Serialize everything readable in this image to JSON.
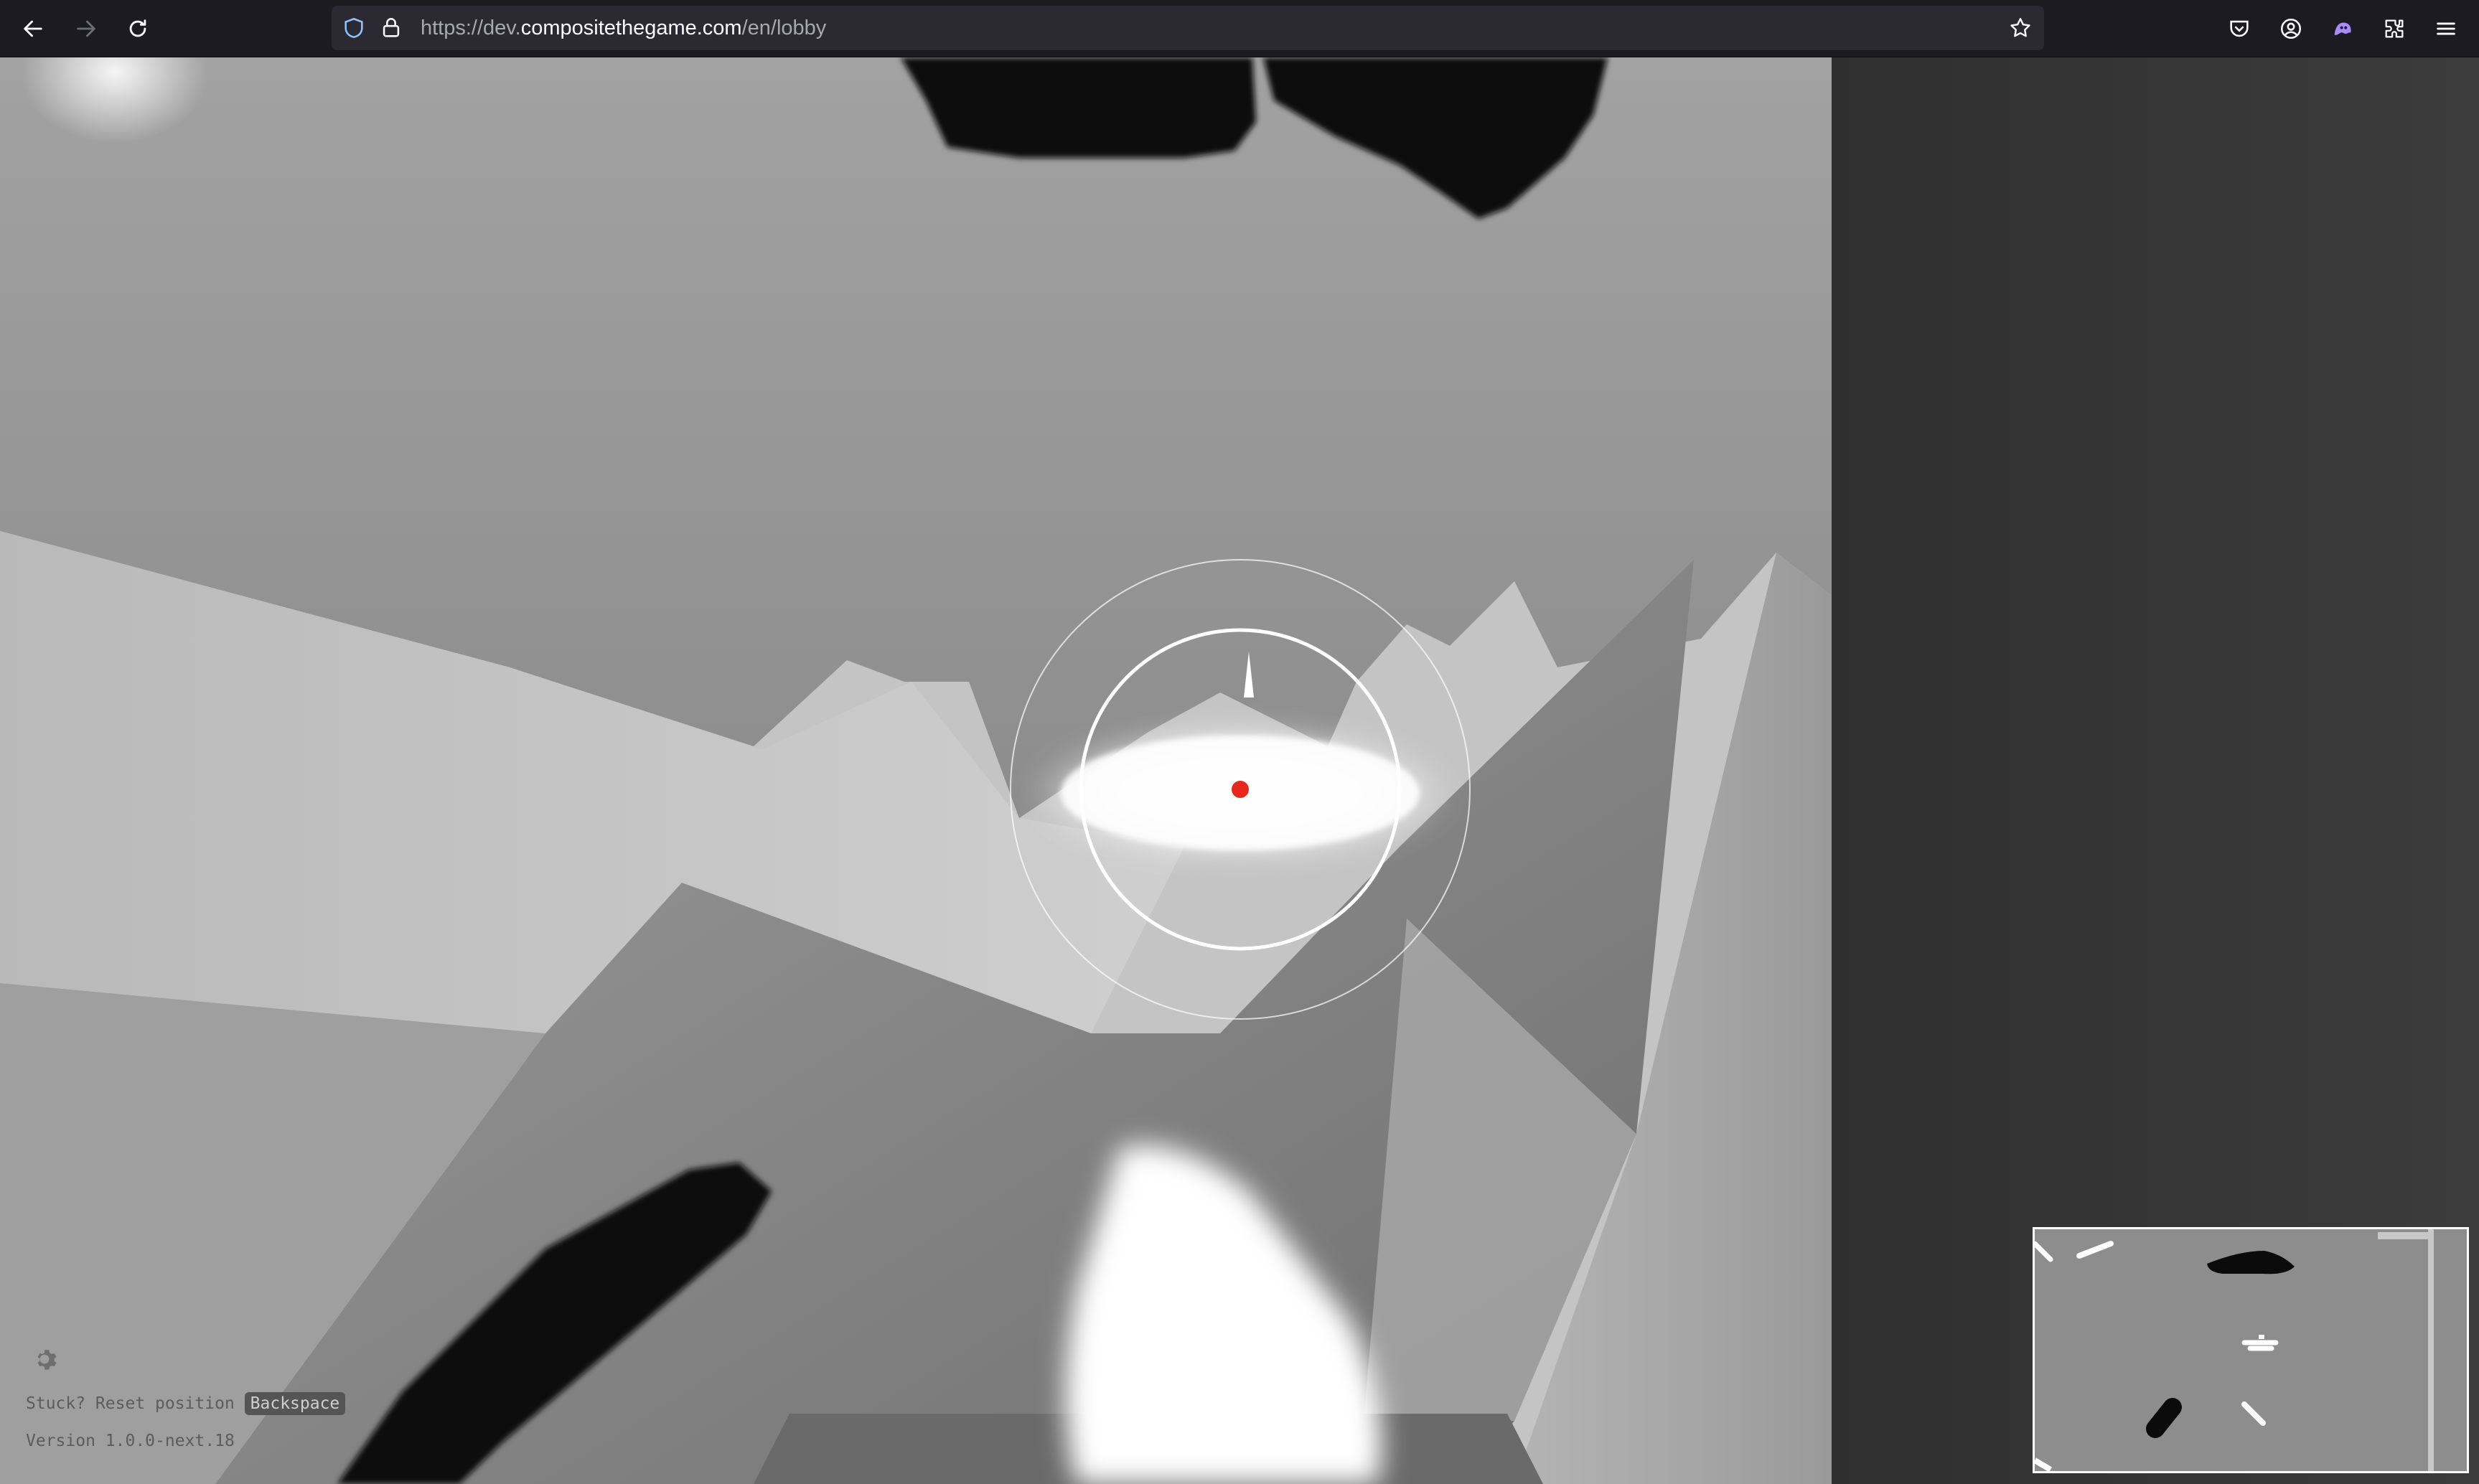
{
  "browser": {
    "url": {
      "scheme": "https://",
      "subdomain": "dev.",
      "domain": "compositethegame.com",
      "path": "/en/lobby"
    }
  },
  "game": {
    "hud": {
      "reset_hint_prefix": "Stuck? Reset position",
      "reset_key": "Backspace",
      "version": "Version 1.0.0-next.18"
    }
  },
  "colors": {
    "toolbar_bg": "#1c1b22",
    "urlbar_bg": "#2b2a33",
    "player_dot": "#e8261c",
    "blob": "#111111",
    "side_panel": "#333333"
  },
  "icons": [
    "back-arrow-icon",
    "forward-arrow-icon",
    "reload-icon",
    "shield-icon",
    "lock-icon",
    "star-icon",
    "pocket-icon",
    "account-icon",
    "extension-ghost-icon",
    "puzzle-icon",
    "menu-icon",
    "gear-icon"
  ]
}
